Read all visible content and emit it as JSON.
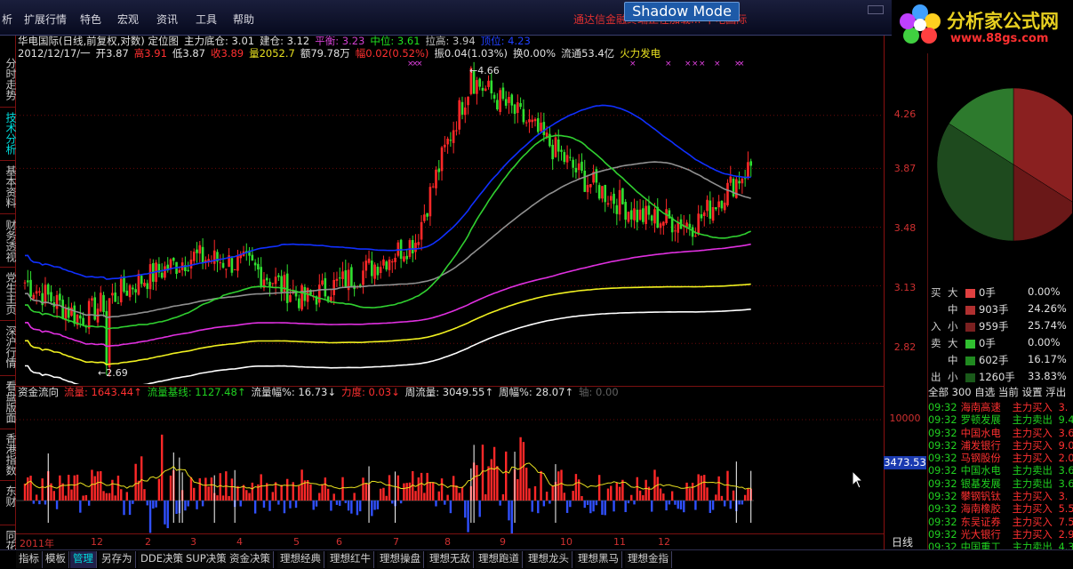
{
  "menu": {
    "items": [
      "析",
      "扩展行情",
      "特色",
      "宏观",
      "资讯",
      "工具",
      "帮助"
    ],
    "notice": "通达信金融终端正在加载...  中电国际",
    "shadow_mode": "Shadow Mode"
  },
  "logo": {
    "title": "分析家公式网",
    "url": "www.88gs.com"
  },
  "left_tabs": [
    "分时走势",
    "技术分析",
    "基本资料",
    "财务透视",
    "党生主页",
    "深沪行情",
    "看盘版面",
    "香港指数",
    "东财",
    "同花"
  ],
  "header": {
    "line1": [
      {
        "text": "华电国际(日线,前复权,对数) 定位图",
        "color": "#e0e0e0"
      },
      {
        "text": "主力底仓: 3.01",
        "color": "#e0e0e0"
      },
      {
        "text": "建仓: 3.12",
        "color": "#e0e0e0"
      },
      {
        "text": "平衡: 3.23",
        "color": "#d040d0"
      },
      {
        "text": "中位: 3.61",
        "color": "#20e020"
      },
      {
        "text": "拉高: 3.94",
        "color": "#c0c0c0"
      },
      {
        "text": "顶位: 4.23",
        "color": "#2040ff"
      }
    ],
    "line2": [
      {
        "text": "2012/12/17/一",
        "color": "#e0e0e0"
      },
      {
        "text": "开3.87",
        "color": "#e0e0e0"
      },
      {
        "text": "高3.91",
        "color": "#ff3030"
      },
      {
        "text": "低3.87",
        "color": "#e0e0e0"
      },
      {
        "text": "收3.89",
        "color": "#ff3030"
      },
      {
        "text": "量2052.7",
        "color": "#e8e020"
      },
      {
        "text": "额79.78万",
        "color": "#e0e0e0"
      },
      {
        "text": "幅0.02(0.52%)",
        "color": "#ff3030"
      },
      {
        "text": "振0.04(1.03%)",
        "color": "#e0e0e0"
      },
      {
        "text": "换0.00%",
        "color": "#e0e0e0"
      },
      {
        "text": "流通53.4亿",
        "color": "#e0e0e0"
      },
      {
        "text": "火力发电",
        "color": "#e8e020"
      }
    ]
  },
  "y_axis_labels": [
    "4.26",
    "3.87",
    "3.48",
    "3.13",
    "2.82",
    "10000",
    "3473.53"
  ],
  "annotations": {
    "high": "4.66",
    "low": "2.69"
  },
  "volume_header": [
    {
      "text": "资金流向",
      "color": "#e0e0e0"
    },
    {
      "text": "流量: 1643.44↑",
      "color": "#ff3030"
    },
    {
      "text": "流量基线: 1127.48↑",
      "color": "#20d020"
    },
    {
      "text": "流量幅%: 16.73↓",
      "color": "#e0e0e0"
    },
    {
      "text": "力度: 0.03↓",
      "color": "#ff3030"
    },
    {
      "text": "周流量: 3049.55↑",
      "color": "#e0e0e0"
    },
    {
      "text": "周幅%: 28.07↑",
      "color": "#e0e0e0"
    },
    {
      "text": "轴: 0.00",
      "color": "#606060"
    }
  ],
  "x_axis": [
    "2011年",
    "12",
    "2",
    "3",
    "4",
    "5",
    "6",
    "7",
    "8",
    "9",
    "10",
    "11",
    "12"
  ],
  "day_label": "日线",
  "pie": {
    "segments": [
      {
        "name": "大卖",
        "color": "#8a2020",
        "value": 0.34
      },
      {
        "name": "中卖",
        "color": "#6a1818",
        "value": 0.16
      },
      {
        "name": "小卖",
        "color": "#1e4a1e",
        "value": 0.34
      },
      {
        "name": "大买",
        "color": "#2d7a2d",
        "value": 0.16
      }
    ]
  },
  "flow_table": [
    {
      "side": "买",
      "size": "大",
      "color": "#e04040",
      "vol": "0手",
      "pct": "0.00%"
    },
    {
      "side": "",
      "size": "中",
      "color": "#b03030",
      "vol": "903手",
      "pct": "24.26%"
    },
    {
      "side": "入",
      "size": "小",
      "color": "#7a2020",
      "vol": "959手",
      "pct": "25.74%"
    },
    {
      "side": "卖",
      "size": "大",
      "color": "#30c030",
      "vol": "0手",
      "pct": "0.00%"
    },
    {
      "side": "",
      "size": "中",
      "color": "#208a20",
      "vol": "602手",
      "pct": "16.17%"
    },
    {
      "side": "出",
      "size": "小",
      "color": "#1a5a1a",
      "vol": "1260手",
      "pct": "33.83%"
    }
  ],
  "right_tabs": "全部 300 自选 当前 设置 浮出",
  "trades": [
    {
      "time": "09:32",
      "name": "海南高速",
      "action": "主力买入",
      "val": "3.",
      "color": "#ff3030"
    },
    {
      "time": "09:32",
      "name": "罗顿发展",
      "action": "主力卖出",
      "val": "9.4",
      "color": "#20d020"
    },
    {
      "time": "09:32",
      "name": "中国水电",
      "action": "主力买入",
      "val": "3.6",
      "color": "#ff3030"
    },
    {
      "time": "09:32",
      "name": "浦发银行",
      "action": "主力买入",
      "val": "9.0",
      "color": "#ff3030"
    },
    {
      "time": "09:32",
      "name": "马钢股份",
      "action": "主力买入",
      "val": "2.0",
      "color": "#ff3030"
    },
    {
      "time": "09:32",
      "name": "中国水电",
      "action": "主力卖出",
      "val": "3.6",
      "color": "#20d020"
    },
    {
      "time": "09:32",
      "name": "银基发展",
      "action": "主力卖出",
      "val": "3.6",
      "color": "#20d020"
    },
    {
      "time": "09:32",
      "name": "攀钢钒钛",
      "action": "主力买入",
      "val": "3.",
      "color": "#ff3030"
    },
    {
      "time": "09:32",
      "name": "海南橡胶",
      "action": "主力买入",
      "val": "5.5",
      "color": "#ff3030"
    },
    {
      "time": "09:32",
      "name": "东吴证券",
      "action": "主力买入",
      "val": "7.5",
      "color": "#ff3030"
    },
    {
      "time": "09:32",
      "name": "光大银行",
      "action": "主力买入",
      "val": "2.9",
      "color": "#ff3030"
    },
    {
      "time": "09:32",
      "name": "中国重工",
      "action": "主力卖出",
      "val": "4.3",
      "color": "#20d020"
    }
  ],
  "bottom_tabs": [
    "指标",
    "模板",
    "管理",
    "另存为",
    "DDE决策",
    "SUP决策",
    "资金决策",
    "理想经典",
    "理想红牛",
    "理想操盘",
    "理想无敌",
    "理想跑道",
    "理想龙头",
    "理想黑马",
    "理想金指"
  ],
  "chart_data": {
    "type": "candlestick",
    "title": "华电国际(日线,前复权,对数) 定位图",
    "xlabel": "",
    "ylabel": "",
    "x": [
      "2011-11",
      "2011-12",
      "2012-01",
      "2012-02",
      "2012-03",
      "2012-04",
      "2012-05",
      "2012-06",
      "2012-07",
      "2012-08",
      "2012-09",
      "2012-10",
      "2012-11",
      "2012-12"
    ],
    "close_approx": [
      3.15,
      2.95,
      3.15,
      3.3,
      3.25,
      3.05,
      3.2,
      3.4,
      4.55,
      4.2,
      3.8,
      3.55,
      3.5,
      3.89
    ],
    "ylim": [
      2.62,
      4.75
    ],
    "log_scale": true,
    "high": 4.66,
    "low": 2.69,
    "levels": {
      "主力底仓": 3.01,
      "建仓": 3.12,
      "平衡": 3.23,
      "中位": 3.61,
      "拉高": 3.94,
      "顶位": 4.23
    },
    "volume": {
      "current": 1643.44,
      "baseline": 1127.48,
      "ymax": 10000
    }
  }
}
